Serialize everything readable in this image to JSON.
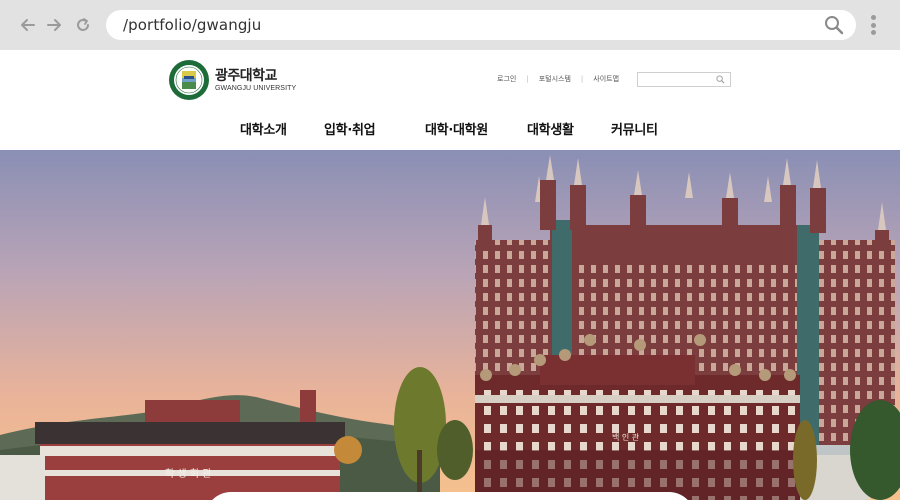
{
  "browser": {
    "url": "/portfolio/gwangju",
    "icons": [
      "back-arrow-icon",
      "forward-arrow-icon",
      "reload-icon",
      "search-icon",
      "kebab-menu-icon"
    ]
  },
  "site": {
    "logo": {
      "name_ko": "광주대학교",
      "name_en": "GWANGJU UNIVERSITY"
    },
    "utility": [
      "로그인",
      "포털시스템",
      "사이트맵"
    ],
    "search": {
      "placeholder": ""
    },
    "nav": [
      "대학소개",
      "입학·취업",
      "대학·대학원",
      "대학생활",
      "커뮤니티"
    ]
  },
  "hero": {
    "sign_building_left": "학 생 회 관",
    "sign_building_right": "백 인 관"
  },
  "colors": {
    "chrome": "#e2e2e2",
    "brand_green": "#1e6b3a",
    "brick": "#7a3b3b",
    "sky_top": "#8a8fb5",
    "sky_bottom": "#f2b98a"
  }
}
